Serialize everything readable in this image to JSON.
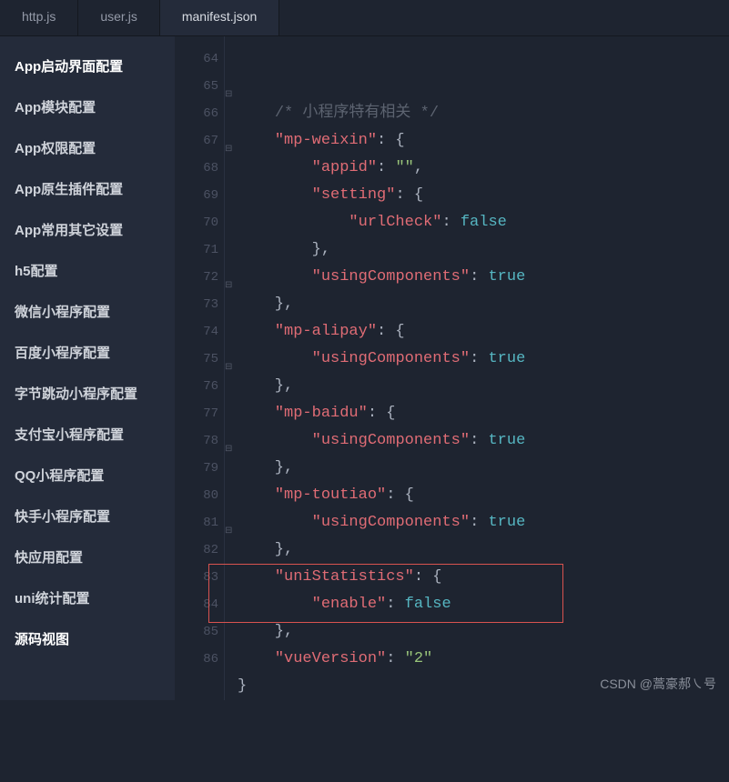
{
  "tabs": [
    {
      "label": "http.js"
    },
    {
      "label": "user.js"
    },
    {
      "label": "manifest.json"
    }
  ],
  "sidebar": {
    "items": [
      {
        "label": "App启动界面配置"
      },
      {
        "label": "App模块配置"
      },
      {
        "label": "App权限配置"
      },
      {
        "label": "App原生插件配置"
      },
      {
        "label": "App常用其它设置"
      },
      {
        "label": "h5配置"
      },
      {
        "label": "微信小程序配置"
      },
      {
        "label": "百度小程序配置"
      },
      {
        "label": "字节跳动小程序配置"
      },
      {
        "label": "支付宝小程序配置"
      },
      {
        "label": "QQ小程序配置"
      },
      {
        "label": "快手小程序配置"
      },
      {
        "label": "快应用配置"
      },
      {
        "label": "uni统计配置"
      },
      {
        "label": "源码视图"
      }
    ]
  },
  "code": {
    "lines": [
      {
        "n": "64",
        "seg": [
          {
            "t": "    ",
            "c": "tp"
          },
          {
            "t": "/* 小程序特有相关 */",
            "c": "tc"
          }
        ]
      },
      {
        "n": "65",
        "fold": true,
        "seg": [
          {
            "t": "    ",
            "c": "tp"
          },
          {
            "t": "\"mp-weixin\"",
            "c": "tk"
          },
          {
            "t": ": {",
            "c": "tp"
          }
        ]
      },
      {
        "n": "66",
        "seg": [
          {
            "t": "        ",
            "c": "tp"
          },
          {
            "t": "\"appid\"",
            "c": "tk"
          },
          {
            "t": ": ",
            "c": "tp"
          },
          {
            "t": "\"\"",
            "c": "ts"
          },
          {
            "t": ",",
            "c": "tp"
          }
        ]
      },
      {
        "n": "67",
        "fold": true,
        "seg": [
          {
            "t": "        ",
            "c": "tp"
          },
          {
            "t": "\"setting\"",
            "c": "tk"
          },
          {
            "t": ": {",
            "c": "tp"
          }
        ]
      },
      {
        "n": "68",
        "seg": [
          {
            "t": "            ",
            "c": "tp"
          },
          {
            "t": "\"urlCheck\"",
            "c": "tk"
          },
          {
            "t": ": ",
            "c": "tp"
          },
          {
            "t": "false",
            "c": "tv"
          }
        ]
      },
      {
        "n": "69",
        "seg": [
          {
            "t": "        },",
            "c": "tp"
          }
        ]
      },
      {
        "n": "70",
        "seg": [
          {
            "t": "        ",
            "c": "tp"
          },
          {
            "t": "\"usingComponents\"",
            "c": "tk"
          },
          {
            "t": ": ",
            "c": "tp"
          },
          {
            "t": "true",
            "c": "tv"
          }
        ]
      },
      {
        "n": "71",
        "seg": [
          {
            "t": "    },",
            "c": "tp"
          }
        ]
      },
      {
        "n": "72",
        "fold": true,
        "seg": [
          {
            "t": "    ",
            "c": "tp"
          },
          {
            "t": "\"mp-alipay\"",
            "c": "tk"
          },
          {
            "t": ": {",
            "c": "tp"
          }
        ]
      },
      {
        "n": "73",
        "seg": [
          {
            "t": "        ",
            "c": "tp"
          },
          {
            "t": "\"usingComponents\"",
            "c": "tk"
          },
          {
            "t": ": ",
            "c": "tp"
          },
          {
            "t": "true",
            "c": "tv"
          }
        ]
      },
      {
        "n": "74",
        "seg": [
          {
            "t": "    },",
            "c": "tp"
          }
        ]
      },
      {
        "n": "75",
        "fold": true,
        "seg": [
          {
            "t": "    ",
            "c": "tp"
          },
          {
            "t": "\"mp-baidu\"",
            "c": "tk"
          },
          {
            "t": ": {",
            "c": "tp"
          }
        ]
      },
      {
        "n": "76",
        "seg": [
          {
            "t": "        ",
            "c": "tp"
          },
          {
            "t": "\"usingComponents\"",
            "c": "tk"
          },
          {
            "t": ": ",
            "c": "tp"
          },
          {
            "t": "true",
            "c": "tv"
          }
        ]
      },
      {
        "n": "77",
        "seg": [
          {
            "t": "    },",
            "c": "tp"
          }
        ]
      },
      {
        "n": "78",
        "fold": true,
        "seg": [
          {
            "t": "    ",
            "c": "tp"
          },
          {
            "t": "\"mp-toutiao\"",
            "c": "tk"
          },
          {
            "t": ": {",
            "c": "tp"
          }
        ]
      },
      {
        "n": "79",
        "seg": [
          {
            "t": "        ",
            "c": "tp"
          },
          {
            "t": "\"usingComponents\"",
            "c": "tk"
          },
          {
            "t": ": ",
            "c": "tp"
          },
          {
            "t": "true",
            "c": "tv"
          }
        ]
      },
      {
        "n": "80",
        "seg": [
          {
            "t": "    },",
            "c": "tp"
          }
        ]
      },
      {
        "n": "81",
        "fold": true,
        "seg": [
          {
            "t": "    ",
            "c": "tp"
          },
          {
            "t": "\"uniStatistics\"",
            "c": "tk"
          },
          {
            "t": ": {",
            "c": "tp"
          }
        ]
      },
      {
        "n": "82",
        "seg": [
          {
            "t": "        ",
            "c": "tp"
          },
          {
            "t": "\"enable\"",
            "c": "tk"
          },
          {
            "t": ": ",
            "c": "tp"
          },
          {
            "t": "false",
            "c": "tv"
          }
        ]
      },
      {
        "n": "83",
        "seg": [
          {
            "t": "    },",
            "c": "tp"
          }
        ]
      },
      {
        "n": "84",
        "seg": [
          {
            "t": "    ",
            "c": "tp"
          },
          {
            "t": "\"vueVersion\"",
            "c": "tk"
          },
          {
            "t": ": ",
            "c": "tp"
          },
          {
            "t": "\"2\"",
            "c": "ts"
          }
        ]
      },
      {
        "n": "85",
        "seg": [
          {
            "t": "}",
            "c": "tp"
          }
        ]
      },
      {
        "n": "86",
        "seg": [
          {
            "t": "",
            "c": "tp"
          }
        ]
      }
    ]
  },
  "watermark": "CSDN @蒿豪郝㇏号"
}
